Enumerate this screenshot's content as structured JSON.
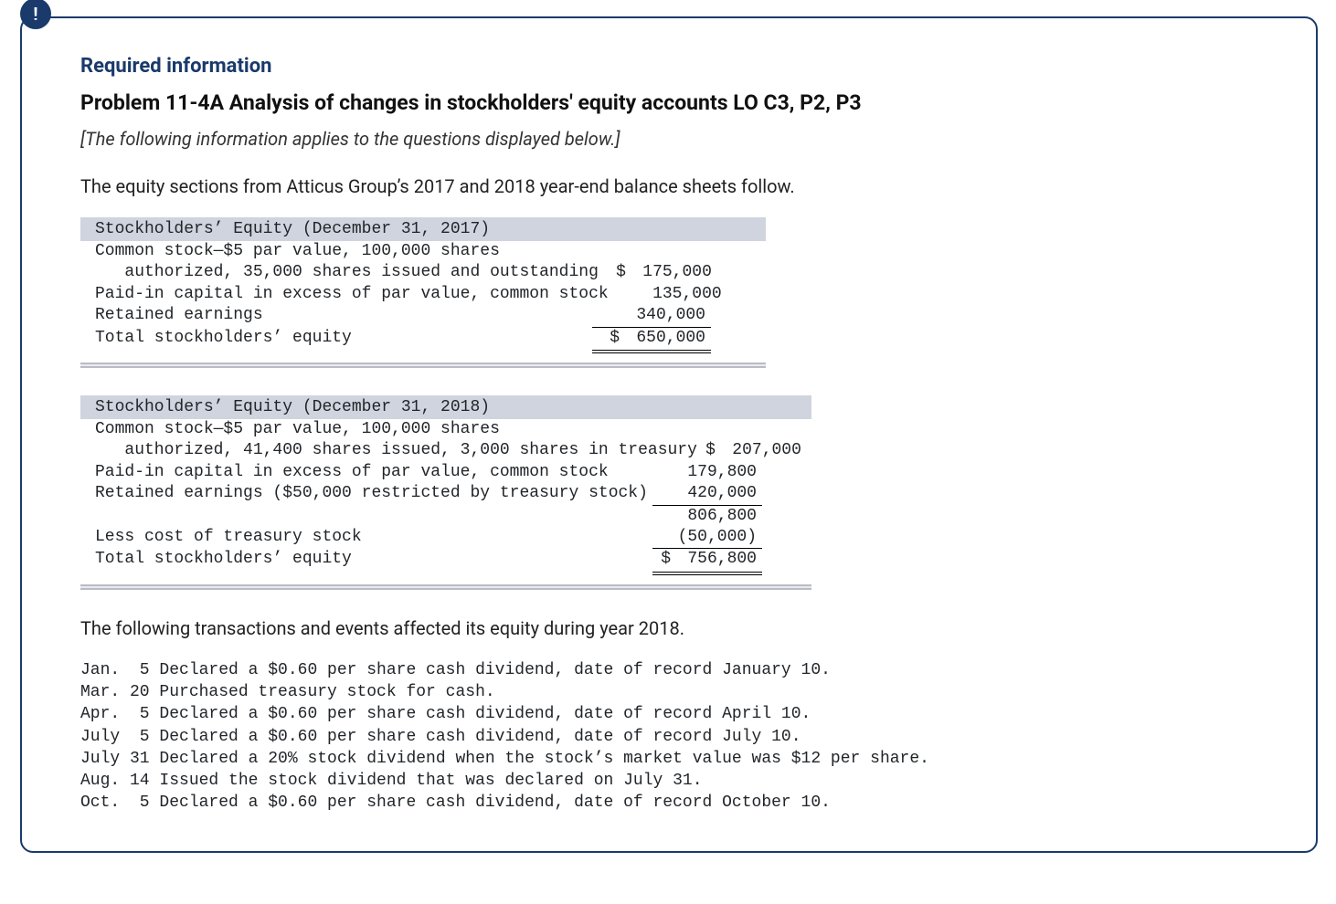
{
  "badge_icon": "!",
  "required_info_label": "Required information",
  "problem_title": "Problem 11-4A Analysis of changes in stockholders' equity accounts LO C3, P2, P3",
  "instruction_text": "[The following information applies to the questions displayed below.]",
  "intro_text": "The equity sections from Atticus Group’s 2017 and 2018 year-end balance sheets follow.",
  "equity_2017": {
    "header": "Stockholders’ Equity (December 31, 2017)",
    "line1": "Common stock—$5 par value, 100,000 shares",
    "line2_desc": "   authorized, 35,000 shares issued and outstanding",
    "line2_sym": "$",
    "line2_val": "175,000",
    "line3_desc": "Paid-in capital in excess of par value, common stock",
    "line3_val": "135,000",
    "line4_desc": "Retained earnings",
    "line4_val": "340,000",
    "total_desc": "Total stockholders’ equity",
    "total_sym": "$",
    "total_val": "650,000"
  },
  "equity_2018": {
    "header": "Stockholders’ Equity (December 31, 2018)",
    "line1": "Common stock—$5 par value, 100,000 shares",
    "line2_desc": "   authorized, 41,400 shares issued, 3,000 shares in treasury",
    "line2_sym": "$",
    "line2_val": "207,000",
    "line3_desc": "Paid-in capital in excess of par value, common stock",
    "line3_val": "179,800",
    "line4_desc": "Retained earnings ($50,000 restricted by treasury stock)",
    "line4_val": "420,000",
    "subtotal_val": "806,800",
    "less_desc": "Less cost of treasury stock",
    "less_val": "(50,000)",
    "total_desc": "Total stockholders’ equity",
    "total_sym": "$",
    "total_val": "756,800"
  },
  "transactions_intro": "The following transactions and events affected its equity during year 2018.",
  "transactions": {
    "t1": "Jan.  5 Declared a $0.60 per share cash dividend, date of record January 10.",
    "t2": "Mar. 20 Purchased treasury stock for cash.",
    "t3": "Apr.  5 Declared a $0.60 per share cash dividend, date of record April 10.",
    "t4": "July  5 Declared a $0.60 per share cash dividend, date of record July 10.",
    "t5": "July 31 Declared a 20% stock dividend when the stock’s market value was $12 per share.",
    "t6": "Aug. 14 Issued the stock dividend that was declared on July 31.",
    "t7": "Oct.  5 Declared a $0.60 per share cash dividend, date of record October 10."
  }
}
